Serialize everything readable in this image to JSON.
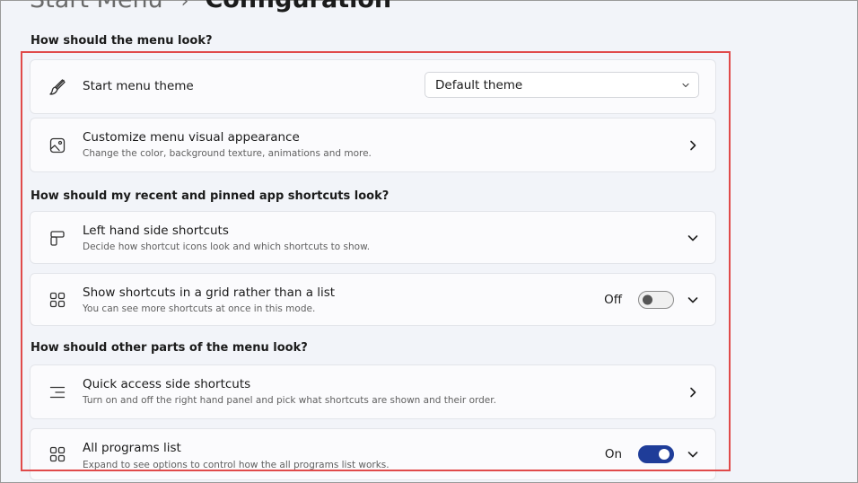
{
  "header": {
    "parent": "Start Menu",
    "separator": "›",
    "current": "Configuration"
  },
  "sections": [
    {
      "title": "How should the menu look?"
    },
    {
      "title": "How should my recent and pinned app shortcuts look?"
    },
    {
      "title": "How should other parts of the menu look?"
    }
  ],
  "cards": {
    "theme": {
      "title": "Start menu theme",
      "dropdown_value": "Default theme",
      "icon": "brush-icon"
    },
    "appearance": {
      "title": "Customize menu visual appearance",
      "desc": "Change the color, background texture, animations and more.",
      "icon": "image-icon"
    },
    "left_side": {
      "title": "Left hand side shortcuts",
      "desc": "Decide how shortcut icons look and which shortcuts to show.",
      "icon": "layout-icon"
    },
    "grid": {
      "title": "Show shortcuts in a grid rather than a list",
      "desc": "You can see more shortcuts at once in this mode.",
      "toggle_label": "Off",
      "toggle_on": false,
      "icon": "grid-icon"
    },
    "quick_access": {
      "title": "Quick access side shortcuts",
      "desc": "Turn on and off the right hand panel and pick what shortcuts are shown and their order.",
      "icon": "lines-icon"
    },
    "all_programs": {
      "title": "All programs list",
      "desc": "Expand to see options to control how the all programs list works.",
      "toggle_label": "On",
      "toggle_on": true,
      "icon": "grid-icon"
    }
  },
  "colors": {
    "accent": "#1f3d99",
    "highlight": "#e04a4a",
    "background": "#f2f4f9"
  }
}
